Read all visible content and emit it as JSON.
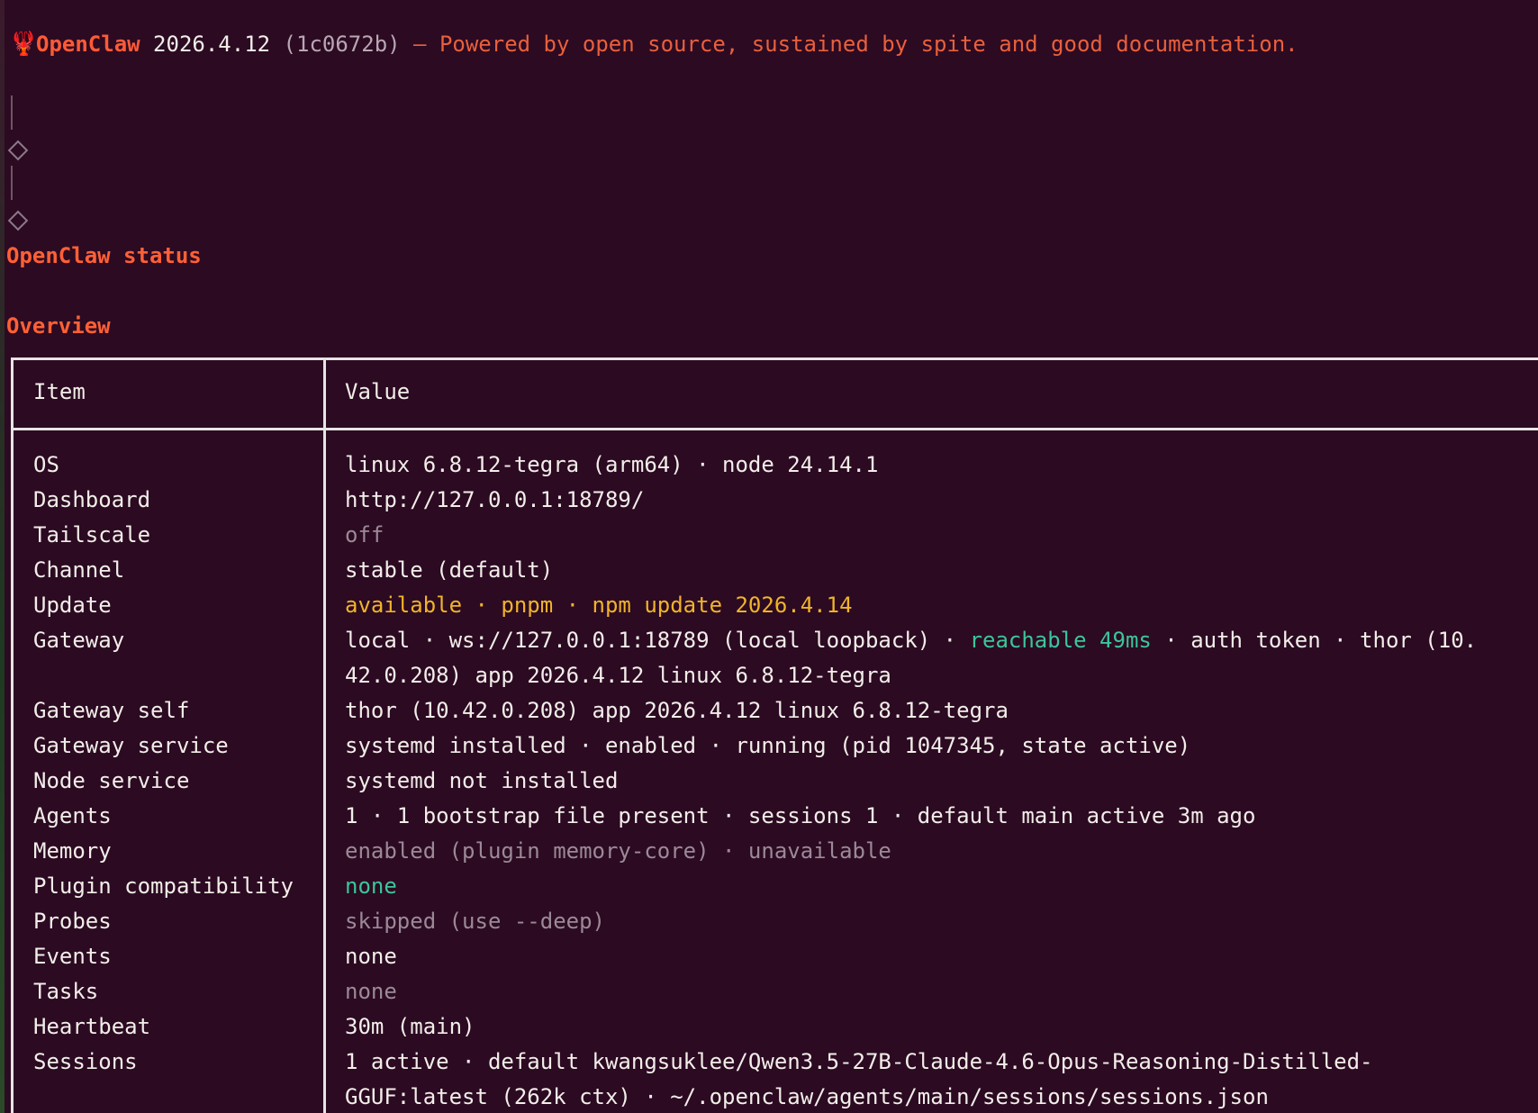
{
  "banner": {
    "brand": "OpenClaw",
    "version": "2026.4.12",
    "commit": "(1c0672b)",
    "tagline": "— Powered by open source, sustained by spite and good documentation."
  },
  "icons": {
    "logo": "lobster-icon",
    "markers": [
      "diamond-icon",
      "diamond-icon"
    ]
  },
  "headings": {
    "status": "OpenClaw status",
    "overview": "Overview"
  },
  "table": {
    "headers": {
      "item": "Item",
      "value": "Value"
    },
    "rows": [
      {
        "item": "OS",
        "value": "linux 6.8.12-tegra (arm64) · node 24.14.1"
      },
      {
        "item": "Dashboard",
        "value": "http://127.0.0.1:18789/"
      },
      {
        "item": "Tailscale",
        "value": "off"
      },
      {
        "item": "Channel",
        "value": "stable (default)"
      },
      {
        "item": "Update",
        "value": "available · pnpm · npm update 2026.4.14"
      },
      {
        "item": "Gateway",
        "value_a": "local · ws://127.0.0.1:18789 (local loopback) · ",
        "value_b": "reachable 49ms",
        "value_c": " · auth token · thor (10.",
        "value_d": "42.0.208) app 2026.4.12 linux 6.8.12-tegra"
      },
      {
        "item": "Gateway self",
        "value": "thor (10.42.0.208) app 2026.4.12 linux 6.8.12-tegra"
      },
      {
        "item": "Gateway service",
        "value": "systemd installed · enabled · running (pid 1047345, state active)"
      },
      {
        "item": "Node service",
        "value": "systemd not installed"
      },
      {
        "item": "Agents",
        "value": "1 · 1 bootstrap file present · sessions 1 · default main active 3m ago"
      },
      {
        "item": "Memory",
        "value": "enabled (plugin memory-core) · unavailable"
      },
      {
        "item": "Plugin compatibility",
        "value": "none"
      },
      {
        "item": "Probes",
        "value": "skipped (use --deep)"
      },
      {
        "item": "Events",
        "value": "none"
      },
      {
        "item": "Tasks",
        "value": "none"
      },
      {
        "item": "Heartbeat",
        "value": "30m (main)"
      },
      {
        "item": "Sessions",
        "value_a": "1 active · default kwangsuklee/Qwen3.5-27B-Claude-4.6-Opus-Reasoning-Distilled-",
        "value_b": "GGUF:latest (262k ctx) · ~/.openclaw/agents/main/sessions/sessions.json"
      }
    ]
  },
  "colors": {
    "background": "#2c0a22",
    "brand": "#ff5a36",
    "warning": "#f0b429",
    "success": "#3cc59a",
    "muted": "#9b8a96"
  }
}
